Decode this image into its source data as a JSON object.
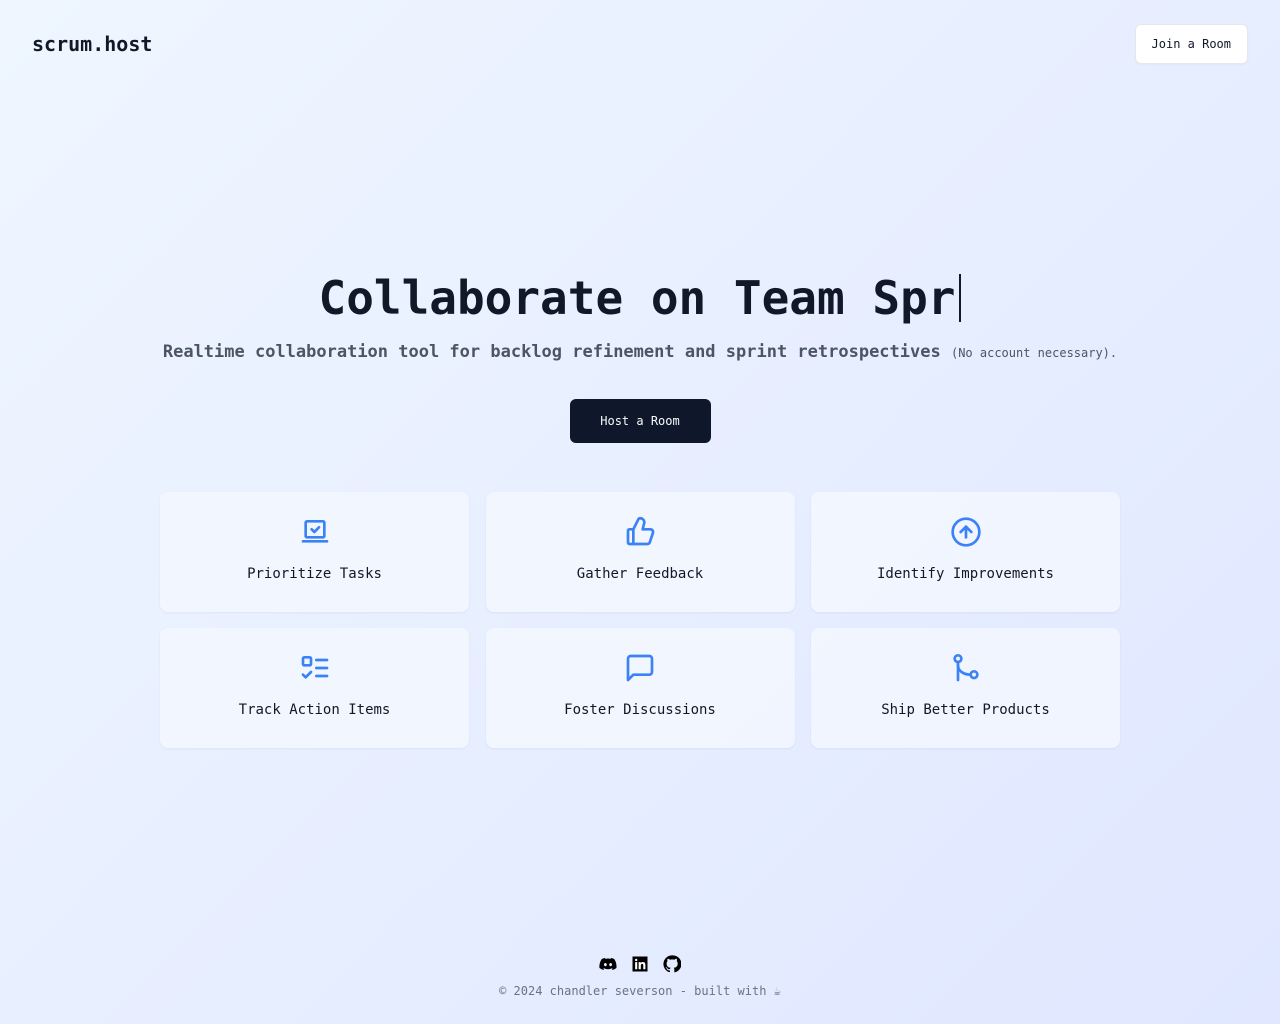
{
  "header": {
    "logo": "scrum.host",
    "join_button": "Join a Room"
  },
  "hero": {
    "title": "Collaborate on Team Spr",
    "subtitle": "Realtime collaboration tool for backlog refinement and sprint retrospectives",
    "subtitle_note": "(No account necessary).",
    "host_button": "Host a Room"
  },
  "features": [
    {
      "icon": "laptop-check-icon",
      "label": "Prioritize Tasks"
    },
    {
      "icon": "thumbs-up-icon",
      "label": "Gather Feedback"
    },
    {
      "icon": "arrow-up-circle-icon",
      "label": "Identify Improvements"
    },
    {
      "icon": "list-checks-icon",
      "label": "Track Action Items"
    },
    {
      "icon": "message-square-icon",
      "label": "Foster Discussions"
    },
    {
      "icon": "git-branch-icon",
      "label": "Ship Better Products"
    }
  ],
  "footer": {
    "socials": [
      "discord-icon",
      "linkedin-icon",
      "github-icon"
    ],
    "copyright": "© 2024 chandler severson - built with ☕"
  },
  "colors": {
    "accent": "#3b82f6",
    "primary_button": "#0f172a",
    "text": "#111827",
    "muted_text": "#4b5563"
  }
}
